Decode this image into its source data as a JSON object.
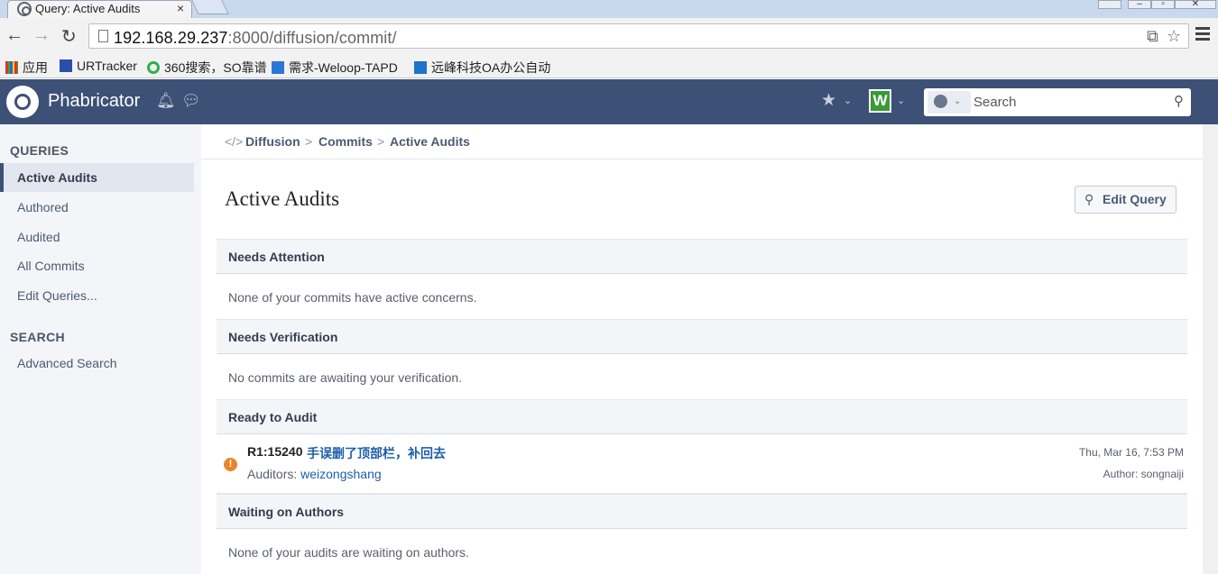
{
  "browser": {
    "tab_title": "Query: Active Audits",
    "tab_close": "×",
    "url_host": "192.168.29.237",
    "url_rest": ":8000/diffusion/commit/",
    "bookmarks": [
      "应用",
      "URTracker",
      "360搜索，SO靠谱",
      "需求-Weloop-TAPD",
      "远峰科技OA办公自动"
    ]
  },
  "header": {
    "app_name": "Phabricator",
    "badge_letter": "W",
    "search_placeholder": "Search"
  },
  "sidebar": {
    "queries_heading": "QUERIES",
    "queries": [
      "Active Audits",
      "Authored",
      "Audited",
      "All Commits",
      "Edit Queries..."
    ],
    "search_heading": "SEARCH",
    "search_items": [
      "Advanced Search"
    ]
  },
  "breadcrumbs": {
    "icon": "</>",
    "items": [
      "Diffusion",
      "Commits",
      "Active Audits"
    ],
    "separator": ">"
  },
  "page": {
    "title": "Active Audits",
    "edit_query_label": "Edit Query"
  },
  "sections": {
    "needs_attention": {
      "title": "Needs Attention",
      "message": "None of your commits have active concerns."
    },
    "needs_verification": {
      "title": "Needs Verification",
      "message": "No commits are awaiting your verification."
    },
    "ready_to_audit": {
      "title": "Ready to Audit"
    },
    "waiting_on_authors": {
      "title": "Waiting on Authors",
      "message": "None of your audits are waiting on authors."
    }
  },
  "commit": {
    "id": "R1:15240",
    "message": "手误删了顶部栏，补回去",
    "auditors_label": "Auditors:",
    "auditor": "weizongshang",
    "date": "Thu, Mar 16, 7:53 PM",
    "author": "Author: songnaiji",
    "status_color": "#e8862c"
  },
  "colors": {
    "header_bg": "#3d5177",
    "link": "#1e5fa8"
  }
}
